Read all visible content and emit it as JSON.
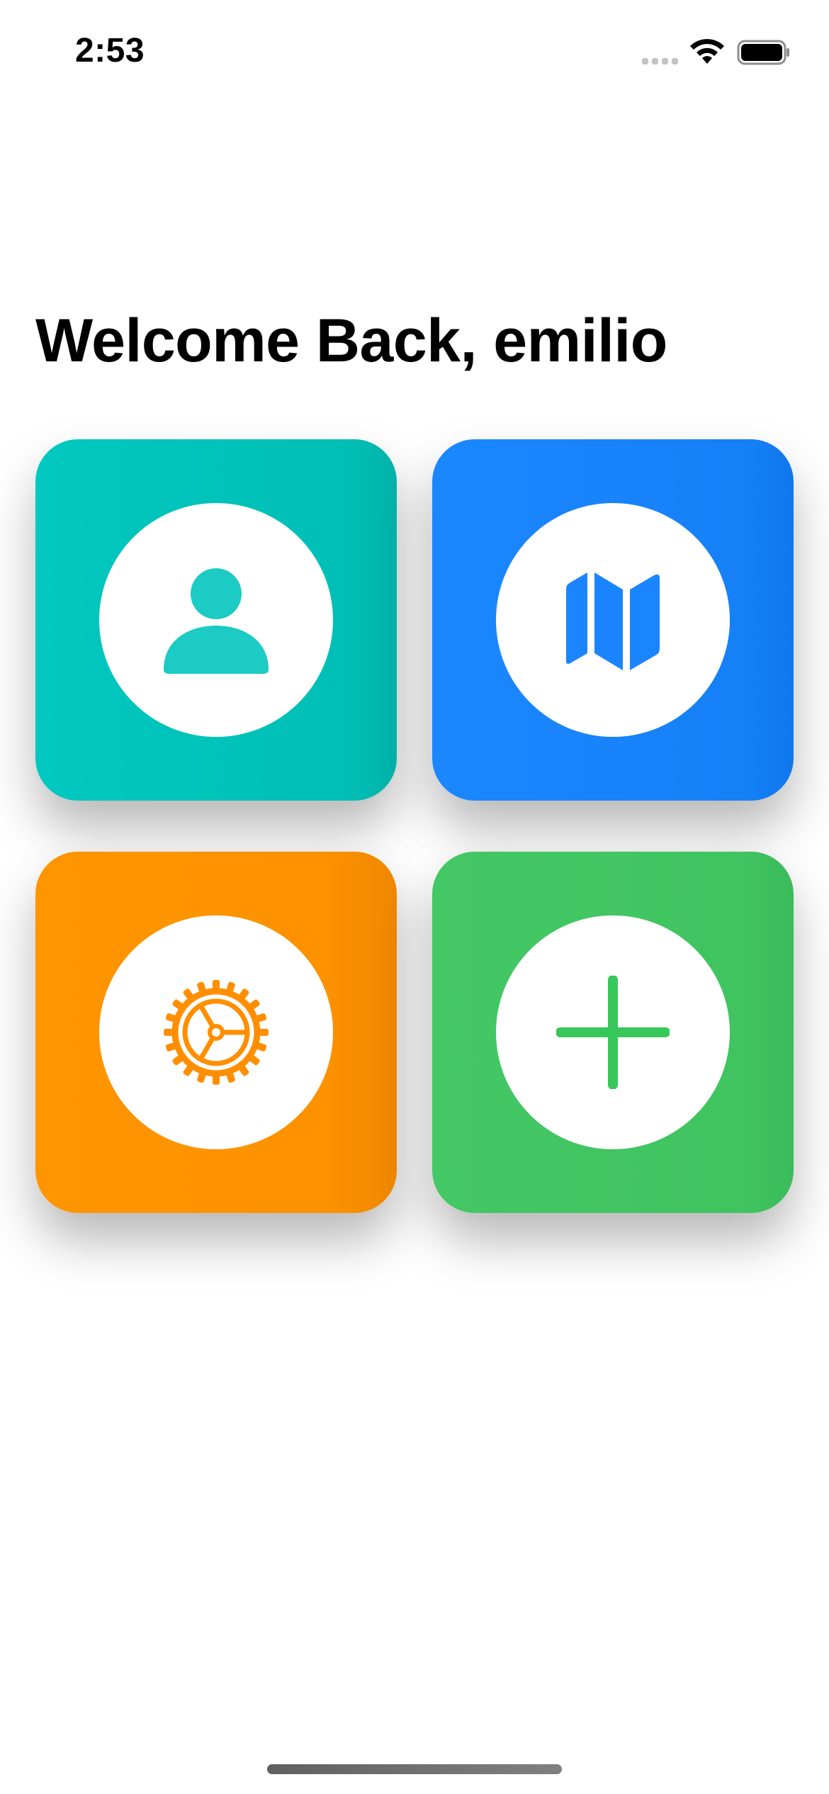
{
  "status_bar": {
    "time": "2:53",
    "wifi_icon": "wifi-icon",
    "battery_icon": "battery-icon",
    "signal_icon": "cellular-signal-icon"
  },
  "header": {
    "title": "Welcome Back, emilio"
  },
  "tiles": [
    {
      "name": "profile",
      "icon": "person-icon",
      "color": "#00C7BE"
    },
    {
      "name": "map",
      "icon": "map-icon",
      "color": "#1A85FF"
    },
    {
      "name": "settings",
      "icon": "gear-icon",
      "color": "#FF9500"
    },
    {
      "name": "add",
      "icon": "plus-icon",
      "color": "#44C765"
    }
  ],
  "colors": {
    "background": "#FFFFFF",
    "title_text": "#000000",
    "teal": "#00C7BE",
    "blue": "#1A85FF",
    "orange": "#FF9500",
    "green": "#44C765"
  }
}
